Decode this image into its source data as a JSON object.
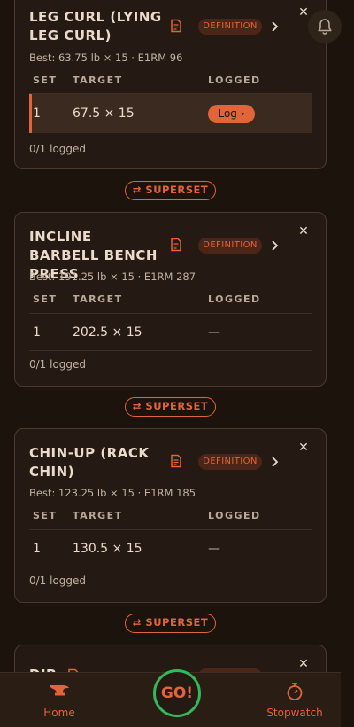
{
  "columns": {
    "set": "SET",
    "target": "TARGET",
    "logged": "LOGGED"
  },
  "exercises": [
    {
      "name": "LEG CURL (LYING LEG CURL)",
      "definition_label": "DEFINITION",
      "best": "Best: 63.75 lb × 15 · E1RM 96",
      "sets": [
        {
          "num": "1",
          "target": "67.5 × 15",
          "logged": "Log ›"
        }
      ],
      "logged_count": "0/1 logged"
    },
    {
      "name": "INCLINE BARBELL BENCH PRESS",
      "definition_label": "DEFINITION",
      "best": "Best: 191.25 lb × 15 · E1RM 287",
      "sets": [
        {
          "num": "1",
          "target": "202.5 × 15",
          "logged": "—"
        }
      ],
      "logged_count": "0/1 logged"
    },
    {
      "name": "CHIN-UP (RACK CHIN)",
      "definition_label": "DEFINITION",
      "best": "Best: 123.25 lb × 15 · E1RM 185",
      "sets": [
        {
          "num": "1",
          "target": "130.5 × 15",
          "logged": "—"
        }
      ],
      "logged_count": "0/1 logged"
    },
    {
      "name": "DIP",
      "definition_label": "DEFINITION"
    }
  ],
  "superset_label": "⇄ SUPERSET",
  "close_glyph": "✕",
  "nav": {
    "home": "Home",
    "go": "GO!",
    "stopwatch": "Stopwatch"
  },
  "colors": {
    "accent": "#e0653a",
    "go_ring": "#35b85a",
    "background": "#1c130d",
    "card": "#241a13"
  }
}
